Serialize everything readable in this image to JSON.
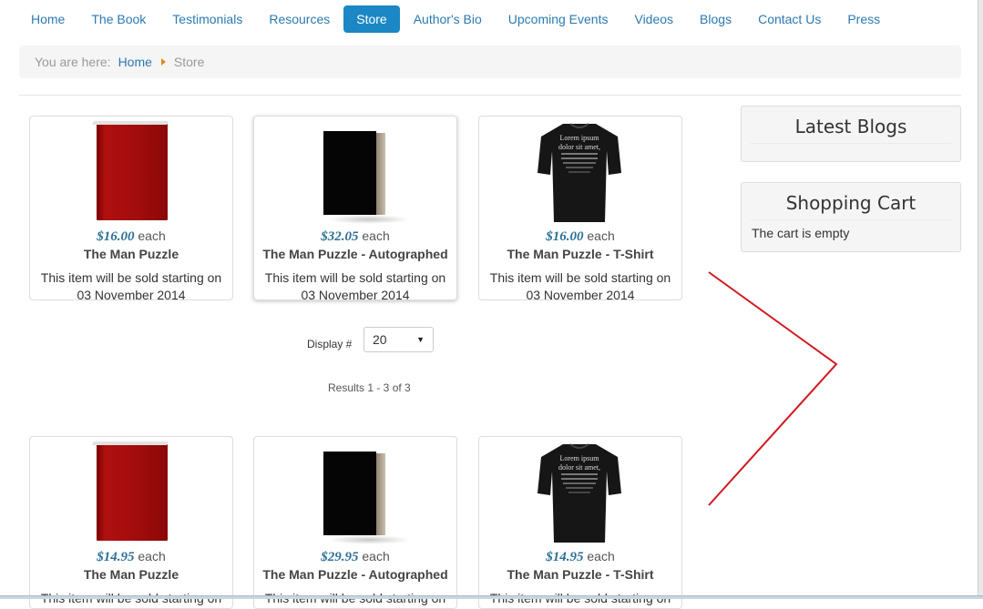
{
  "nav": {
    "items": [
      "Home",
      "The Book",
      "Testimonials",
      "Resources",
      "Store",
      "Author's Bio",
      "Upcoming Events",
      "Videos",
      "Blogs",
      "Contact Us",
      "Press"
    ],
    "active": "Store"
  },
  "breadcrumb": {
    "lead": "You are here:",
    "home": "Home",
    "current": "Store"
  },
  "products_top": [
    {
      "price": "$16.00",
      "each": "each",
      "name": "The Man Puzzle",
      "note": "This item will be sold starting on 03 November 2014"
    },
    {
      "price": "$32.05",
      "each": "each",
      "name": "The Man Puzzle - Autographed",
      "note": "This item will be sold starting on 03 November 2014"
    },
    {
      "price": "$16.00",
      "each": "each",
      "name": "The Man Puzzle - T-Shirt",
      "note": "This item will be sold starting on 03 November 2014"
    }
  ],
  "products_bottom": [
    {
      "price": "$14.95",
      "each": "each",
      "name": "The Man Puzzle",
      "note": "This item will be sold starting on"
    },
    {
      "price": "$29.95",
      "each": "each",
      "name": "The Man Puzzle - Autographed",
      "note": "This item will be sold starting on"
    },
    {
      "price": "$14.95",
      "each": "each",
      "name": "The Man Puzzle - T-Shirt",
      "note": "This item will be sold starting on"
    }
  ],
  "shirt_text": [
    "Lorem ipsum",
    "dolor sit amet,"
  ],
  "display": {
    "label": "Display #",
    "value": "20"
  },
  "results": "Results 1 - 3 of 3",
  "sidebar": {
    "latest_blogs": "Latest Blogs",
    "shopping_cart": "Shopping Cart",
    "cart_status": "The cart is empty"
  },
  "colors": {
    "nav_active": "#1b87c4",
    "link": "#2a7ab0",
    "price": "#2b6f96",
    "annotation": "#d0181e"
  }
}
